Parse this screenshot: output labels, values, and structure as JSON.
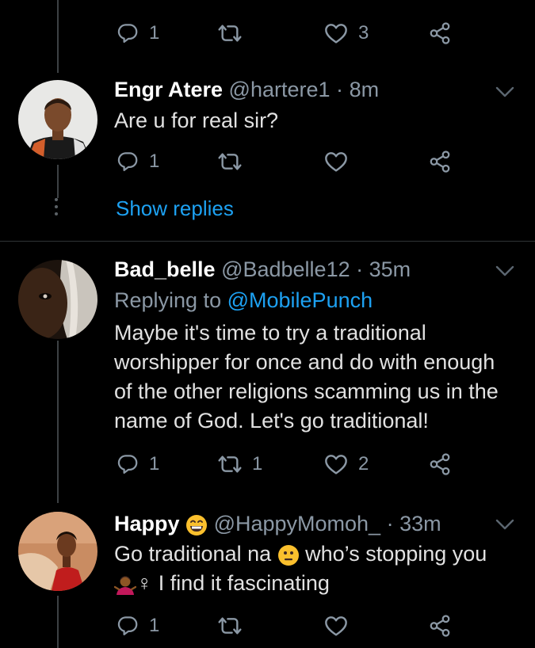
{
  "top_actions": {
    "reply_count": "1",
    "like_count": "3"
  },
  "tweets": [
    {
      "name": "Engr Atere",
      "handle": "@hartere1",
      "dot": "·",
      "time": "8m",
      "text": "Are u for real sir?",
      "reply_count": "1",
      "show_replies": "Show replies"
    },
    {
      "name": "Bad_belle",
      "handle": "@Badbelle12",
      "dot": "·",
      "time": "35m",
      "replying_label": "Replying to",
      "replying_mention": "@MobilePunch",
      "text": "Maybe it's time to try a traditional worshipper for once and do with enough of the other religions scamming us in the name of God. Let's go traditional!",
      "reply_count": "1",
      "retweet_count": "1",
      "like_count": "2"
    },
    {
      "name": "Happy",
      "handle": "@HappyMomoh_",
      "dot": "·",
      "time": "33m",
      "text_part1": "Go traditional na",
      "text_part2": "who’s stopping you",
      "text_part3": "♀ I find it fascinating",
      "reply_count": "1"
    }
  ],
  "icons": {
    "reply": "reply-icon",
    "retweet": "retweet-icon",
    "like": "heart-icon",
    "share": "share-icon",
    "caret": "chevron-down-icon"
  },
  "colors": {
    "background": "#000000",
    "link": "#1da1f2",
    "muted": "#8b98a5"
  }
}
